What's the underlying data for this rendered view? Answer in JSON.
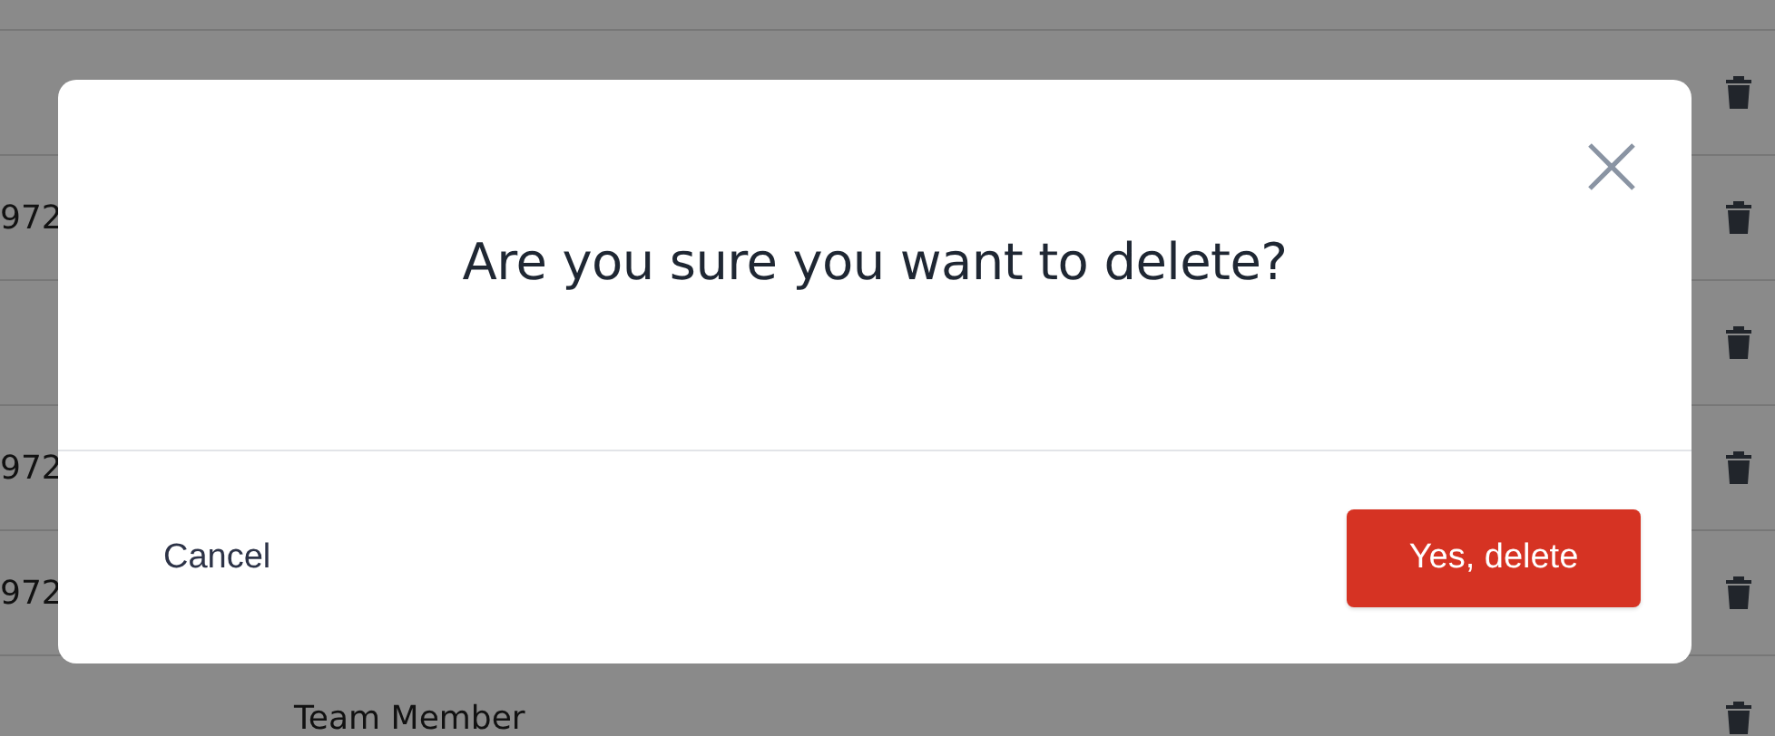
{
  "table": {
    "rows": [
      {
        "column_1": "",
        "column_2": ""
      },
      {
        "column_1": "972",
        "column_2": ""
      },
      {
        "column_1": "",
        "column_2": ""
      },
      {
        "column_1": "972",
        "column_2": ""
      },
      {
        "column_1": "972",
        "column_2": ""
      },
      {
        "column_1": "",
        "column_2": "Team Member"
      }
    ]
  },
  "dialog": {
    "title": "Are you sure you want to delete?",
    "buttons": [
      {
        "label": "Cancel",
        "kind": "text"
      },
      {
        "label": "Yes, delete",
        "kind": "danger"
      }
    ]
  }
}
